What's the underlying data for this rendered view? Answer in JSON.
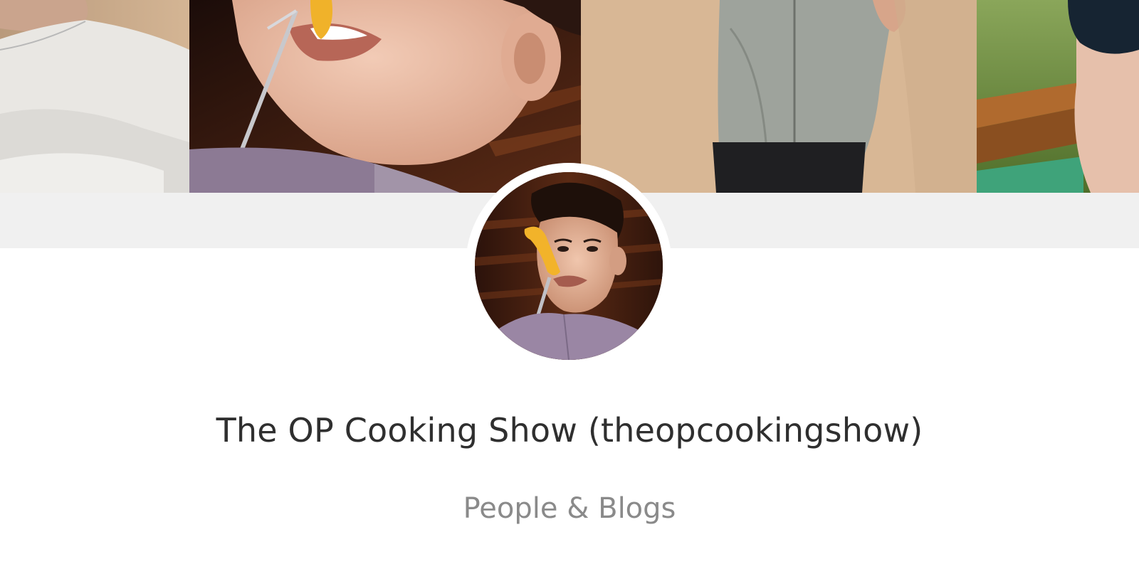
{
  "channel": {
    "title": "The OP Cooking Show (theopcookingshow)",
    "category": "People & Blogs"
  },
  "banner": {
    "panels": [
      {
        "name": "banner-photo-crossed-arms"
      },
      {
        "name": "banner-photo-eating-fork"
      },
      {
        "name": "banner-photo-standing-shirt"
      },
      {
        "name": "banner-photo-sunglasses-outdoor"
      }
    ]
  },
  "colors": {
    "title_text": "#2f2f2f",
    "category_text": "#8a8a8a",
    "band": "#f0f0f0"
  }
}
